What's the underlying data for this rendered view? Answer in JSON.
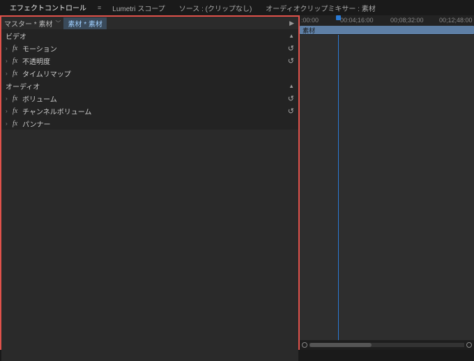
{
  "tabs": {
    "effect_controls": "エフェクトコントロール",
    "lumetri_scopes": "Lumetri スコープ",
    "source": "ソース : (クリップなし)",
    "audio_mixer": "オーディオクリップミキサー : 素材"
  },
  "master": {
    "label": "マスター * 素材",
    "clip": "素材 * 素材"
  },
  "sections": {
    "video": "ビデオ",
    "audio": "オーディオ"
  },
  "video_effects": {
    "motion": "モーション",
    "opacity": "不透明度",
    "time_remap": "タイムリマップ"
  },
  "audio_effects": {
    "volume": "ボリューム",
    "channel_volume": "チャンネルボリューム",
    "panner": "パンナー"
  },
  "timeline": {
    "ticks": [
      ":00:00",
      "00:04;16:00",
      "00;08;32:00",
      "00;12;48:00"
    ],
    "clip_label": "素材"
  }
}
